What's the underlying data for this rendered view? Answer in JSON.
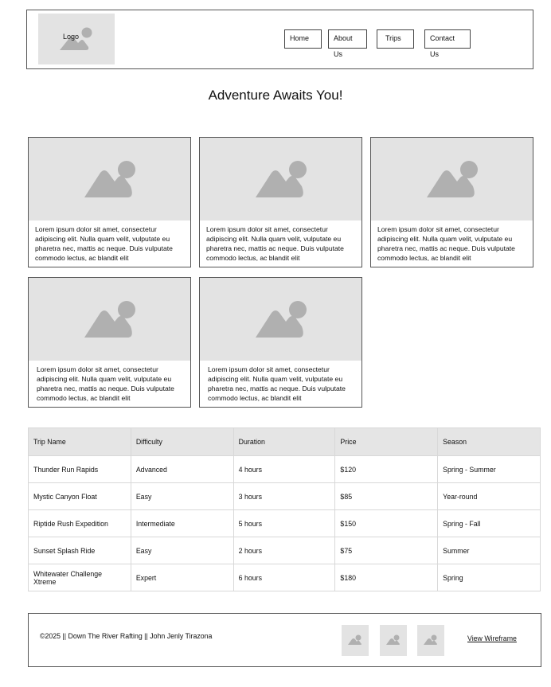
{
  "header": {
    "logo_label": "Logo",
    "nav": [
      "Home",
      "About Us",
      "Trips",
      "Contact Us"
    ]
  },
  "page_title": "Adventure Awaits You!",
  "cards": [
    {
      "text": "Lorem ipsum dolor sit amet, consectetur adipiscing elit. Nulla quam velit, vulputate eu pharetra nec, mattis ac neque. Duis vulputate commodo lectus, ac blandit elit"
    },
    {
      "text": "Lorem ipsum dolor sit amet, consectetur adipiscing elit. Nulla quam velit, vulputate eu pharetra nec, mattis ac neque. Duis vulputate commodo lectus, ac blandit elit"
    },
    {
      "text": "Lorem ipsum dolor sit amet, consectetur adipiscing elit. Nulla quam velit, vulputate eu pharetra nec, mattis ac neque. Duis vulputate commodo lectus, ac blandit elit"
    },
    {
      "text": "Lorem ipsum dolor sit amet, consectetur adipiscing elit. Nulla quam velit, vulputate eu pharetra nec, mattis ac neque. Duis vulputate commodo lectus, ac blandit elit"
    },
    {
      "text": "Lorem ipsum dolor sit amet, consectetur adipiscing elit. Nulla quam velit, vulputate eu pharetra nec, mattis ac neque. Duis vulputate commodo lectus, ac blandit elit"
    }
  ],
  "table": {
    "headers": [
      "Trip Name",
      "Difficulty",
      "Duration",
      "Price",
      "Season"
    ],
    "rows": [
      [
        "Thunder Run Rapids",
        "Advanced",
        "4 hours",
        "$120",
        "Spring - Summer"
      ],
      [
        "Mystic Canyon Float",
        "Easy",
        "3 hours",
        "$85",
        "Year-round"
      ],
      [
        "Riptide Rush Expedition",
        "Intermediate",
        "5 hours",
        "$150",
        "Spring - Fall"
      ],
      [
        "Sunset Splash Ride",
        "Easy",
        "2 hours",
        "$75",
        "Summer"
      ],
      [
        "Whitewater Challenge Xtreme",
        "Expert",
        "6 hours",
        "$180",
        "Spring"
      ]
    ]
  },
  "footer": {
    "copyright": "©2025 || Down The River Rafting || John Jenly Tirazona",
    "link_label": "View Wireframe"
  },
  "icons": {
    "placeholder": "image-placeholder-icon"
  },
  "colors": {
    "placeholder_bg": "#e3e3e3",
    "placeholder_shape": "#b0b0b0",
    "table_header_bg": "#e5e5e5",
    "border": "#555555"
  }
}
